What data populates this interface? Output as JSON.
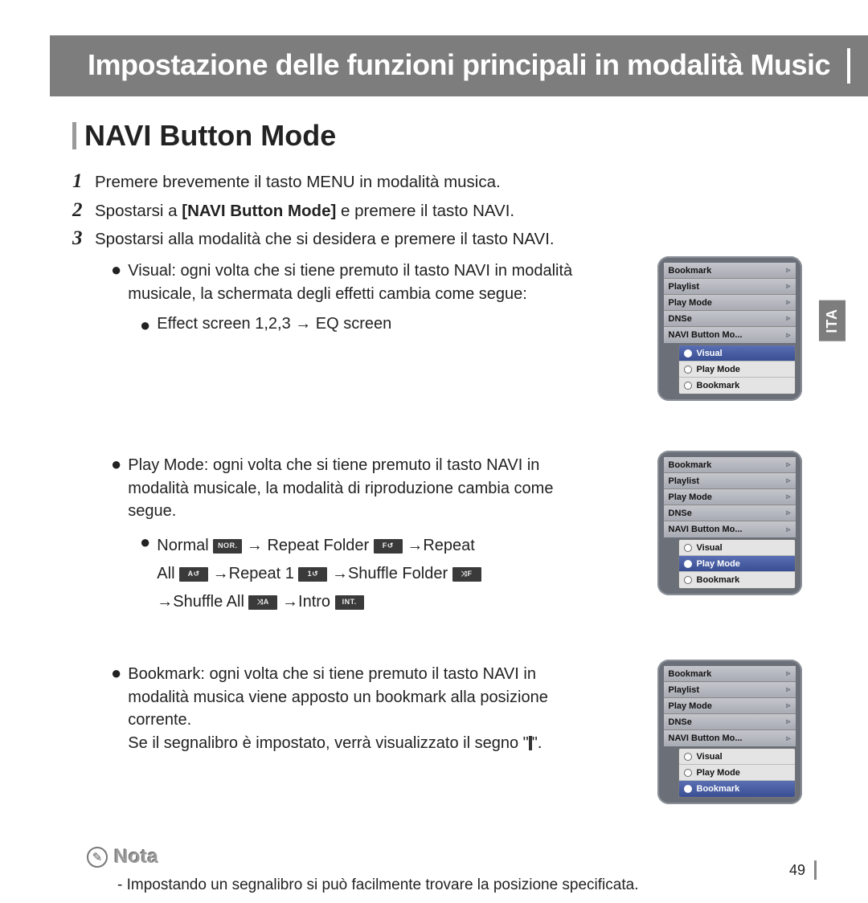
{
  "header": {
    "title": "Impostazione delle funzioni principali in modalità Music"
  },
  "side_tab": "ITA",
  "section_title": "NAVI Button Mode",
  "steps": [
    {
      "text": "Premere brevemente il tasto MENU in modalità musica."
    },
    {
      "prefix": "Spostarsi a ",
      "bold": "[NAVI Button Mode]",
      "suffix": " e premere il tasto NAVI."
    },
    {
      "text": "Spostarsi alla modalità che si desidera e premere il tasto NAVI."
    }
  ],
  "visual_block": {
    "lead": "Visual: ogni volta che si tiene premuto il tasto NAVI in modalità musicale, la schermata degli effetti cambia come segue:",
    "sub": "Effect screen 1,2,3 → EQ screen"
  },
  "playmode_block": {
    "lead": "Play Mode: ogni volta che si tiene premuto il tasto NAVI in modalità musicale, la modalità di riproduzione cambia come segue.",
    "labels": {
      "normal": "Normal",
      "repeat_folder": "Repeat Folder",
      "repeat": "Repeat",
      "all": "All",
      "repeat_1": "Repeat 1",
      "shuffle_folder": "Shuffle Folder",
      "shuffle_all": "Shuffle All",
      "intro": "Intro"
    },
    "icons": {
      "normal": "NOR.",
      "repeat_folder": "F↺",
      "repeat_all": "A↺",
      "repeat_1": "1↺",
      "shuffle_folder": "⤨F",
      "shuffle_all": "⤨A",
      "intro": "INT."
    }
  },
  "bookmark_block": {
    "lead": "Bookmark: ogni volta che si tiene premuto il tasto NAVI in modalità musica viene apposto un bookmark alla posizione corrente.",
    "tail_pre": "Se il segnalibro è impostato, verrà visualizzato il segno \"",
    "tail_post": "\"."
  },
  "note": {
    "label": "Nota",
    "text": "- Impostando un segnalibro si può facilmente trovare la posizione specificata."
  },
  "page_number": "49",
  "device_menu": {
    "items": [
      "Bookmark",
      "Playlist",
      "Play Mode",
      "DNSe",
      "NAVI Button Mo..."
    ],
    "popup": [
      "Visual",
      "Play Mode",
      "Bookmark"
    ]
  },
  "arrow": "→"
}
